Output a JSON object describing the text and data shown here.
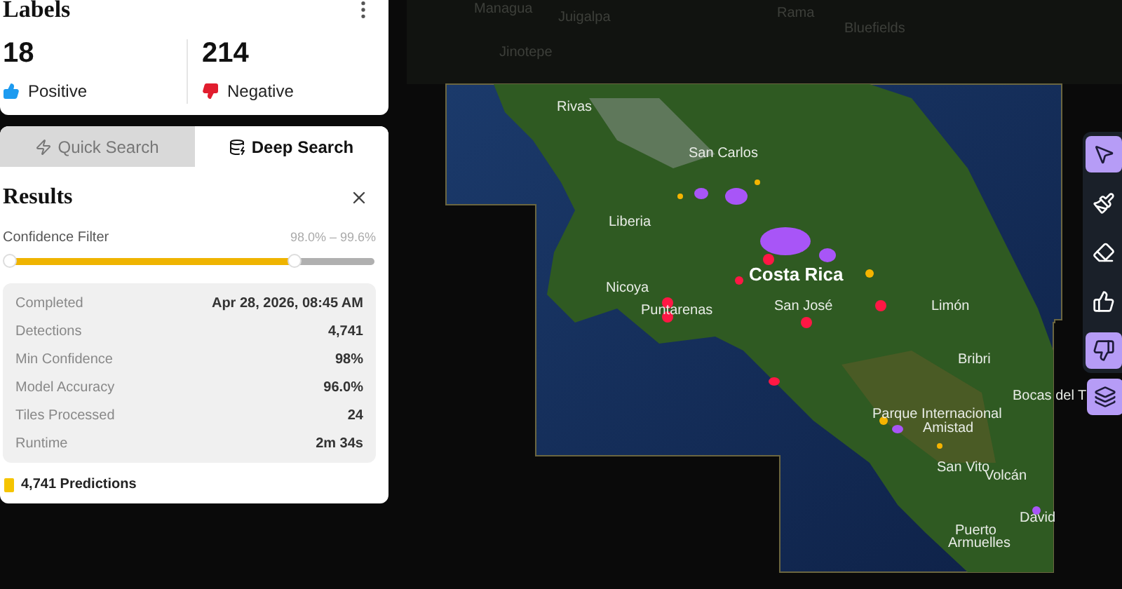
{
  "labels_card": {
    "title": "Labels",
    "stats": [
      {
        "kind": "positive",
        "count": "18",
        "label": "Positive"
      },
      {
        "kind": "negative",
        "count": "214",
        "label": "Negative"
      }
    ]
  },
  "tabs": [
    {
      "kind": "quick",
      "label": "Quick Search",
      "selected": false
    },
    {
      "kind": "deep",
      "label": "Deep Search",
      "selected": true
    }
  ],
  "results": {
    "title": "Results",
    "filter": {
      "label": "Confidence Filter",
      "range": "98.0% – 99.6%",
      "thumbs": [
        {
          "level": 0
        },
        {
          "level": 0.78
        }
      ]
    },
    "rows": [
      {
        "label": "Completed",
        "value": "Apr 28, 2026, 08:45 AM"
      },
      {
        "label": "Detections",
        "value": "4,741"
      },
      {
        "label": "Min Confidence",
        "value": "98%"
      },
      {
        "label": "Model Accuracy",
        "value": "96.0%"
      },
      {
        "label": "Tiles Processed",
        "value": "24"
      },
      {
        "label": "Runtime",
        "value": "2m 34s"
      }
    ],
    "legend": {
      "label": "4,741 Predictions",
      "color": "#f5c400"
    }
  },
  "map_labels": [
    {
      "text": "Managua",
      "kind": "dim"
    },
    {
      "text": "Juigalpa",
      "kind": "dim"
    },
    {
      "text": "Rama",
      "kind": "dim"
    },
    {
      "text": "Bluefields",
      "kind": "dim"
    },
    {
      "text": "Jinotepe",
      "kind": "dim"
    },
    {
      "text": "Rivas",
      "kind": "city"
    },
    {
      "text": "San Carlos",
      "kind": "city"
    },
    {
      "text": "Liberia",
      "kind": "city"
    },
    {
      "text": "Nicoya",
      "kind": "city"
    },
    {
      "text": "Costa Rica",
      "kind": "country"
    },
    {
      "text": "Puntarenas",
      "kind": "city"
    },
    {
      "text": "San José",
      "kind": "city"
    },
    {
      "text": "Limón",
      "kind": "city"
    },
    {
      "text": "Bribri",
      "kind": "city"
    },
    {
      "text": "Bocas del T",
      "kind": "city"
    },
    {
      "text": "Parque Internacional",
      "kind": "city"
    },
    {
      "text": "Amistad",
      "kind": "city"
    },
    {
      "text": "San Vito",
      "kind": "city"
    },
    {
      "text": "Volcán",
      "kind": "city"
    },
    {
      "text": "David",
      "kind": "city"
    },
    {
      "text": "Puerto",
      "kind": "city"
    },
    {
      "text": "Armuelles",
      "kind": "city"
    }
  ],
  "tools": [
    {
      "kind": "select",
      "selected": true
    },
    {
      "kind": "brush",
      "selected": false
    },
    {
      "kind": "eraser",
      "selected": false
    },
    {
      "kind": "thumbs-up",
      "selected": false
    },
    {
      "kind": "thumbs-down",
      "selected": true
    }
  ],
  "layers_button": {
    "selected": true
  }
}
